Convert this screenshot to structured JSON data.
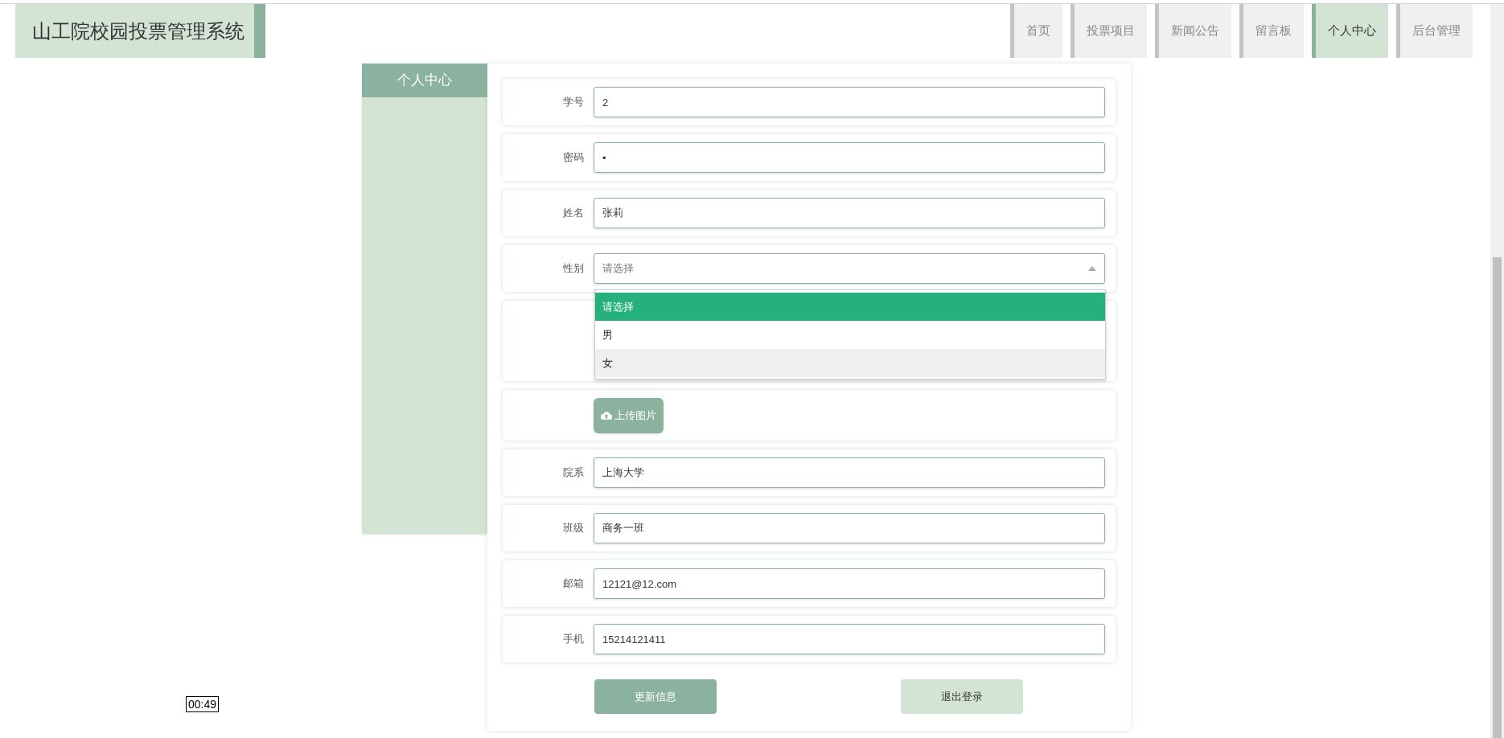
{
  "site_title": "山工院校园投票管理系统",
  "nav": [
    {
      "label": "首页",
      "selected": false
    },
    {
      "label": "投票项目",
      "selected": false
    },
    {
      "label": "新闻公告",
      "selected": false
    },
    {
      "label": "留言板",
      "selected": false
    },
    {
      "label": "个人中心",
      "selected": true
    },
    {
      "label": "后台管理",
      "selected": false
    }
  ],
  "sidebar": {
    "title": "个人中心"
  },
  "form": {
    "fields": [
      {
        "kind": "text",
        "label": "学号",
        "value": "2"
      },
      {
        "kind": "text",
        "label": "密码",
        "value": "•"
      },
      {
        "kind": "text",
        "label": "姓名",
        "value": "张莉"
      },
      {
        "kind": "select",
        "label": "性别",
        "placeholder": "请选择",
        "expanded": true,
        "options": [
          {
            "label": "请选择",
            "selected": true,
            "hovered": false
          },
          {
            "label": "男",
            "selected": false,
            "hovered": false
          },
          {
            "label": "女",
            "selected": false,
            "hovered": true
          }
        ]
      },
      {
        "kind": "image"
      },
      {
        "kind": "upload",
        "button": "上传图片"
      },
      {
        "kind": "text",
        "label": "院系",
        "value": "上海大学"
      },
      {
        "kind": "text",
        "label": "班级",
        "value": "商务一班"
      },
      {
        "kind": "text",
        "label": "邮箱",
        "value": "12121@12.com"
      },
      {
        "kind": "text",
        "label": "手机",
        "value": "15214121411"
      }
    ]
  },
  "buttons": [
    {
      "kind": "primary",
      "label": "更新信息"
    },
    {
      "kind": "secondary",
      "label": "退出登录"
    }
  ],
  "timer": "00:49"
}
